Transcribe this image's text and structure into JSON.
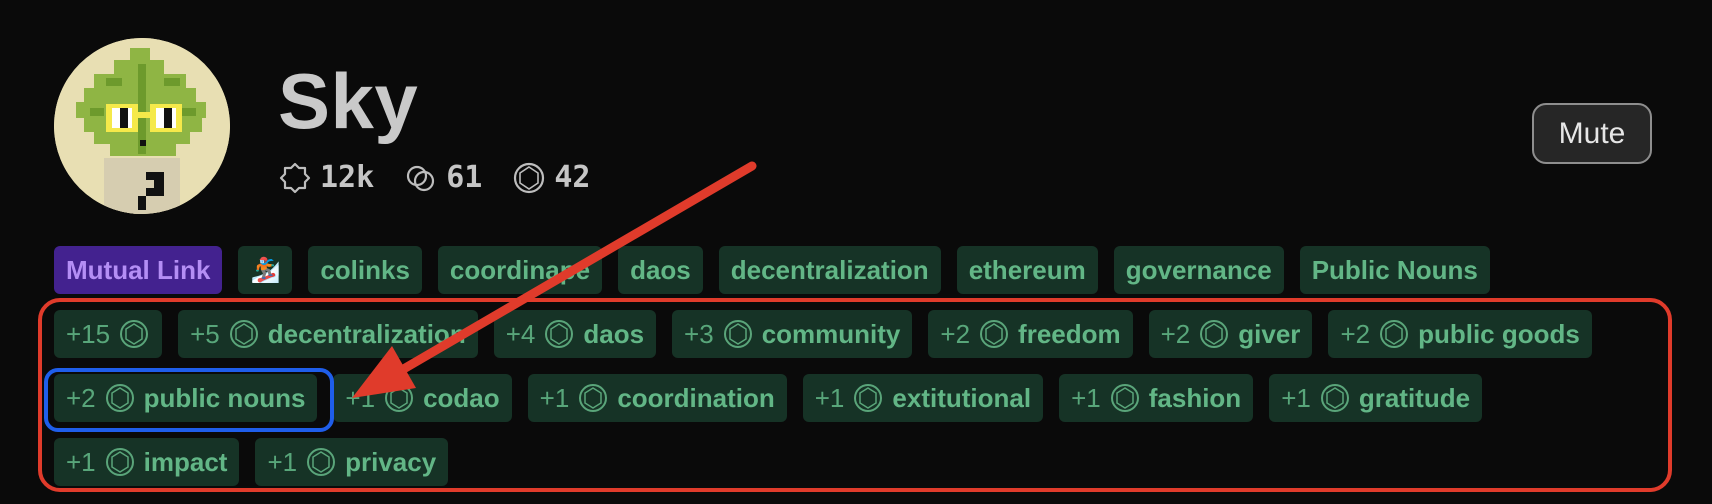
{
  "profile": {
    "name": "Sky",
    "stats": [
      {
        "icon": "badge-icon",
        "value": "12k"
      },
      {
        "icon": "links-icon",
        "value": "61"
      },
      {
        "icon": "gem-icon",
        "value": "42"
      }
    ],
    "mute_label": "Mute"
  },
  "tags": [
    {
      "label": "Mutual Link",
      "kind": "mutual"
    },
    {
      "label": "🏂",
      "kind": "emoji"
    },
    {
      "label": "colinks"
    },
    {
      "label": "coordinape"
    },
    {
      "label": "daos"
    },
    {
      "label": "decentralization"
    },
    {
      "label": "ethereum"
    },
    {
      "label": "governance"
    },
    {
      "label": "Public Nouns"
    }
  ],
  "votes": [
    {
      "count": "+15",
      "label": ""
    },
    {
      "count": "+5",
      "label": "decentralization"
    },
    {
      "count": "+4",
      "label": "daos"
    },
    {
      "count": "+3",
      "label": "community"
    },
    {
      "count": "+2",
      "label": "freedom"
    },
    {
      "count": "+2",
      "label": "giver"
    },
    {
      "count": "+2",
      "label": "public goods"
    },
    {
      "count": "+2",
      "label": "public nouns"
    },
    {
      "count": "+1",
      "label": "codao"
    },
    {
      "count": "+1",
      "label": "coordination"
    },
    {
      "count": "+1",
      "label": "extitutional"
    },
    {
      "count": "+1",
      "label": "fashion"
    },
    {
      "count": "+1",
      "label": "gratitude"
    },
    {
      "count": "+1",
      "label": "impact"
    },
    {
      "count": "+1",
      "label": "privacy"
    }
  ],
  "colors": {
    "tag_bg": "#163326",
    "tag_text": "#62b686",
    "mutual_bg": "#43228f",
    "mutual_text": "#b48ef5",
    "annotation_red": "#e03b2b",
    "annotation_blue": "#1f5eea"
  }
}
